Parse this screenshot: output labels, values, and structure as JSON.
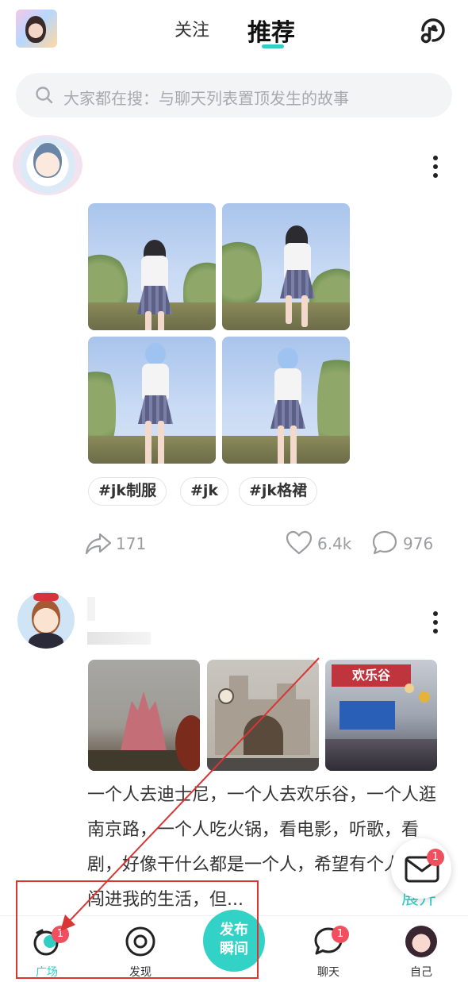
{
  "header": {
    "tabs": [
      {
        "label": "关注",
        "active": false
      },
      {
        "label": "推荐",
        "active": true
      }
    ],
    "accent_color": "#2fcfc4"
  },
  "search": {
    "placeholder": "大家都在搜：与聊天列表置顶发生的故事"
  },
  "feed": {
    "posts": [
      {
        "tags": [
          "#jk制服",
          "#jk",
          "#jk格裙"
        ],
        "shares": "171",
        "likes": "6.4k",
        "comments": "976"
      },
      {
        "text": "一个人去迪士尼，一个人去欢乐谷，一个人逛南京路，一个人吃火锅，看电影，听歌，看剧，好像干什么都是一个人，希望有个人突然闯进我的生活，但...",
        "expand_label": "展开",
        "photo_sign": "欢乐谷"
      }
    ]
  },
  "mail": {
    "badge": "1"
  },
  "bottom_nav": {
    "items": [
      {
        "label": "广场",
        "badge": "1",
        "active": true
      },
      {
        "label": "发现"
      },
      {
        "label": "发布瞬间"
      },
      {
        "label": "聊天",
        "badge": "1"
      },
      {
        "label": "自己"
      }
    ],
    "publish_line1": "发布",
    "publish_line2": "瞬间",
    "badge_color": "#f04f5f"
  }
}
